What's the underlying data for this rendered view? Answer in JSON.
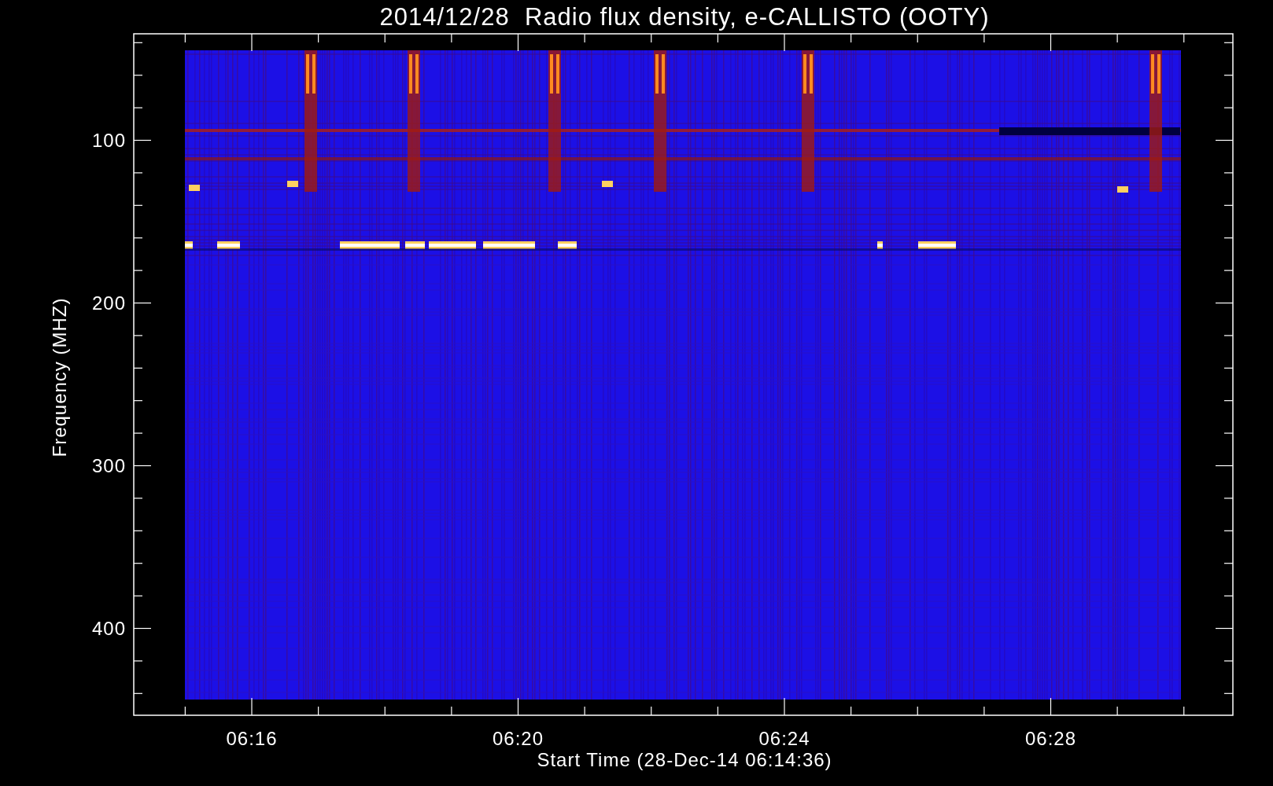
{
  "title": "2014/12/28  Radio flux density, e-CALLISTO (OOTY)",
  "plot": {
    "xlabel": "Start Time (28-Dec-14 06:14:36)",
    "ylabel": "Frequency (MHZ)",
    "xticks": [
      "06:16",
      "06:20",
      "06:24",
      "06:28"
    ],
    "yticks": [
      "100",
      "200",
      "300",
      "400"
    ]
  }
}
